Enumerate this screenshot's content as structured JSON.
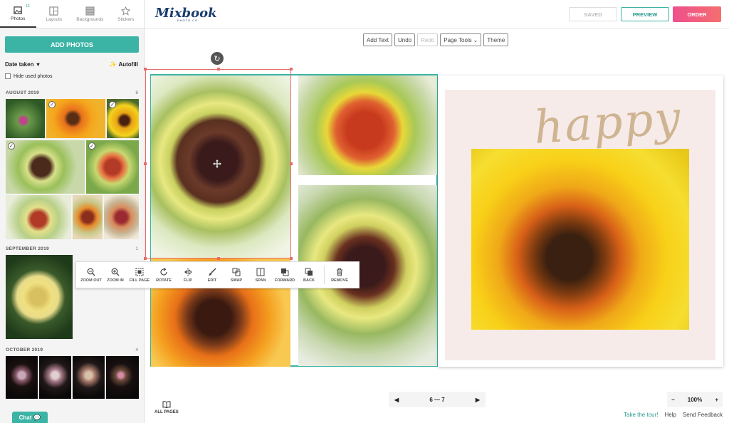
{
  "sidebar": {
    "tabs": [
      {
        "label": "Photos",
        "badge": "13",
        "icon": "photos-icon"
      },
      {
        "label": "Layouts",
        "icon": "layouts-icon"
      },
      {
        "label": "Backgrounds",
        "icon": "backgrounds-icon"
      },
      {
        "label": "Stickers",
        "icon": "star-icon"
      }
    ],
    "add_photos": "ADD PHOTOS",
    "sort_label": "Date taken",
    "autofill_label": "Autofill",
    "hide_used_label": "Hide used photos",
    "months": [
      {
        "name": "AUGUST 2019",
        "count": "8"
      },
      {
        "name": "SEPTEMBER 2019",
        "count": "1"
      },
      {
        "name": "OCTOBER 2019",
        "count": "4"
      }
    ],
    "chat_label": "Chat"
  },
  "header": {
    "logo": "Mixbook",
    "logo_sub": "PHOTO CO.",
    "saved": "SAVED",
    "preview": "PREVIEW",
    "order": "ORDER"
  },
  "toolbar": {
    "add_text": "Add Text",
    "undo": "Undo",
    "redo": "Redo",
    "page_tools": "Page Tools",
    "theme": "Theme"
  },
  "page_right": {
    "title_text": "happy"
  },
  "photo_tools": [
    {
      "label": "ZOOM OUT",
      "icon": "zoom-out-icon"
    },
    {
      "label": "ZOOM IN",
      "icon": "zoom-in-icon"
    },
    {
      "label": "FILL PAGE",
      "icon": "fill-page-icon"
    },
    {
      "label": "ROTATE",
      "icon": "rotate-icon"
    },
    {
      "label": "FLIP",
      "icon": "flip-icon"
    },
    {
      "label": "EDIT",
      "icon": "brush-icon"
    },
    {
      "label": "SWAP",
      "icon": "swap-icon"
    },
    {
      "label": "SPAN",
      "icon": "span-icon"
    },
    {
      "label": "FORWARD",
      "icon": "forward-icon"
    },
    {
      "label": "BACK",
      "icon": "back-icon"
    },
    {
      "label": "REMOVE",
      "icon": "trash-icon"
    }
  ],
  "footer": {
    "all_pages": "ALL PAGES",
    "page_range": "6 — 7",
    "zoom_level": "100%",
    "zoom_minus": "−",
    "zoom_plus": "+",
    "tour": "Take the tour!",
    "help": "Help",
    "feedback": "Send Feedback"
  },
  "colors": {
    "accent": "#3bb3a5",
    "order_gradient_start": "#ef4f8c",
    "selection": "#e86a6a"
  }
}
